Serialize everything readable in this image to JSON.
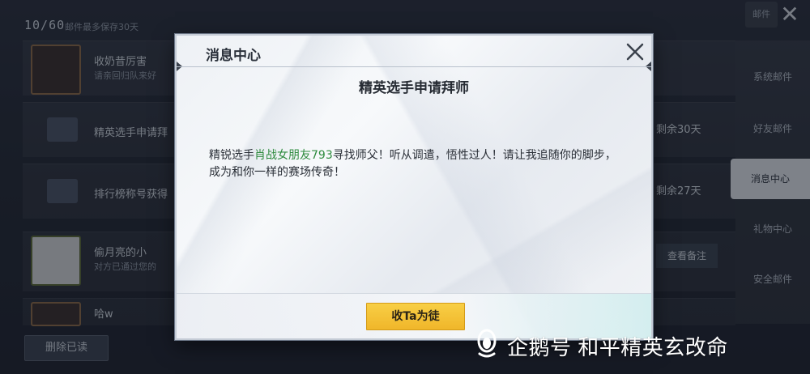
{
  "background": {
    "mail_count": "10/60",
    "mail_keep_note": "邮件最多保存30天",
    "top_right_button": "邮件",
    "rows": [
      {
        "title": "收奶昔厉害",
        "subtitle": "请亲回归队来好",
        "right": ""
      },
      {
        "title": "精英选手申请拜",
        "subtitle": "",
        "right": "剩余30天"
      },
      {
        "title": "排行榜称号获得",
        "subtitle": "",
        "right": "剩余27天"
      },
      {
        "title": "偷月亮的小",
        "subtitle": "对方已通过您的",
        "right": "查看备注"
      },
      {
        "title": "哈w",
        "subtitle": "",
        "right": ""
      }
    ],
    "delete_read_label": "删除已读",
    "sidebar": [
      {
        "label": "系统邮件"
      },
      {
        "label": "好友邮件"
      },
      {
        "label": "消息中心"
      },
      {
        "label": "礼物中心"
      },
      {
        "label": "安全邮件"
      }
    ]
  },
  "dialog": {
    "header_title": "消息中心",
    "subject": "精英选手申请拜师",
    "body": {
      "prefix": "精锐选手",
      "player_name": "肖战女朋友793",
      "suffix": "寻找师父！听从调遣，悟性过人！请让我追随你的脚步，成为和你一样的赛场传奇！"
    },
    "accept_label": "收Ta为徒"
  },
  "watermark": {
    "text": "企鹅号 和平精英玄改命"
  },
  "colors": {
    "accent_button": "#f5c23a",
    "player_link": "#2e8b3e",
    "active_sidebar": "#dce2ea"
  }
}
